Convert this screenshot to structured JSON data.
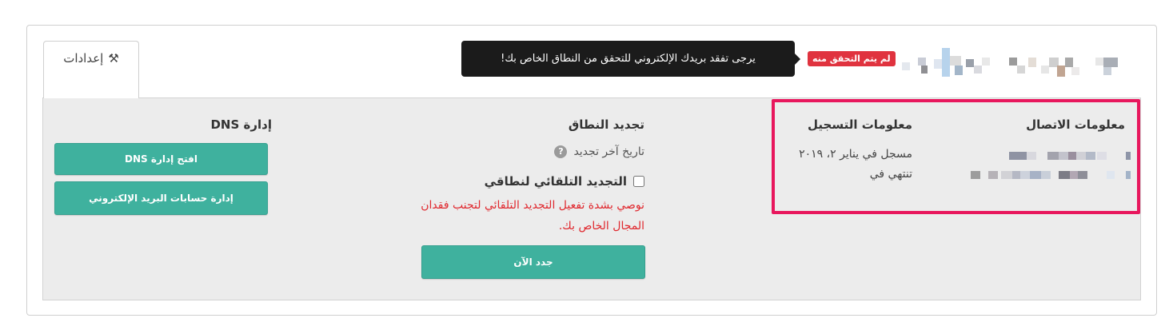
{
  "settings_tab": {
    "label": "إعدادات",
    "icon": "tools-icon"
  },
  "header": {
    "badge_label": "لم يتم التحقق منه",
    "tooltip_text": "يرجى تفقد بريدك الإلكتروني للتحقق من النطاق الخاص بك!",
    "colors": {
      "badge": "#e0333f",
      "tooltip": "#1b1b1b"
    }
  },
  "sections": {
    "contact_title": "معلومات الاتصال",
    "registration_title": "معلومات التسجيل",
    "renewal_title": "تجديد النطاق",
    "dns_title": "إدارة DNS"
  },
  "registration": {
    "registered_line": "مسجل في يناير ٢، ٢٠١٩",
    "expires_line": "تنتهي في"
  },
  "renewal": {
    "last_renewal_label": "تاريخ آخر تجديد",
    "auto_renew_label": "التجديد التلقائي لنطاقي",
    "auto_renew_checked": false,
    "warning_text": "نوصي بشدة تفعيل التجديد التلقائي لتجنب فقدان المجال الخاص بك.",
    "renew_now_button": "جدد الآن"
  },
  "dns": {
    "open_dns_button": "افتح إدارة DNS",
    "email_accounts_button": "إدارة حسابات البريد الإلكتروني"
  },
  "colors": {
    "accent": "#3fb19e",
    "highlight": "#e8175d",
    "warning": "#e0282e",
    "panel": "#ececec"
  }
}
